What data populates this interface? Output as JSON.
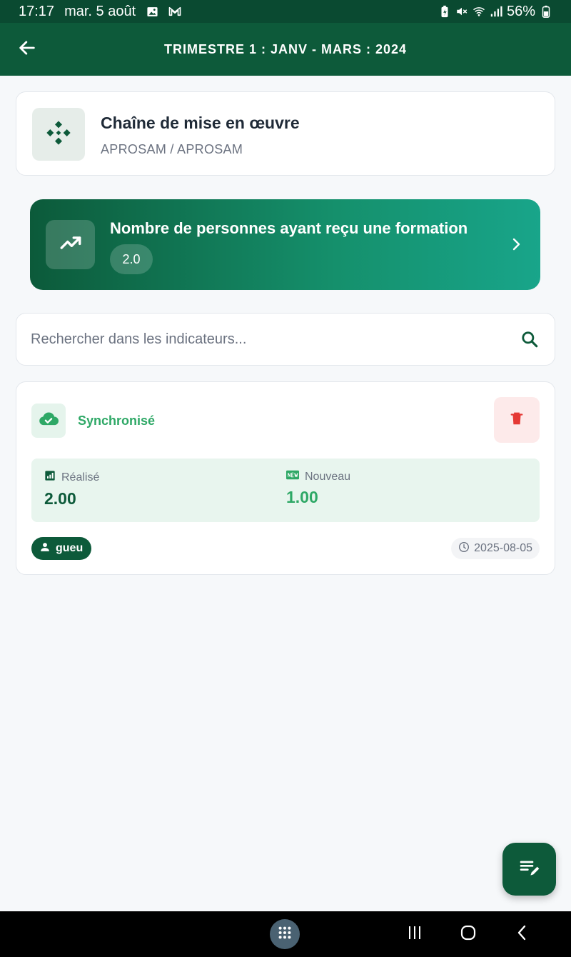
{
  "status_bar": {
    "time": "17:17",
    "date": "mar. 5 août",
    "battery": "56%",
    "icons_left": [
      "image-icon",
      "gmail-icon"
    ],
    "icons_right": [
      "battery-saver-icon",
      "mute-icon",
      "wifi-icon",
      "signal-icon",
      "battery-icon"
    ]
  },
  "app_bar": {
    "title": "TRIMESTRE 1 : JANV - MARS : 2024",
    "back_icon": "arrow-left-icon"
  },
  "chain": {
    "title": "Chaîne de mise en œuvre",
    "subtitle": "APROSAM / APROSAM",
    "icon": "diamond-arrows-icon"
  },
  "indicator": {
    "title": "Nombre de personnes ayant reçu une formation",
    "value": "2.0",
    "icon": "trending-up-icon",
    "chevron": "chevron-right-icon"
  },
  "search": {
    "placeholder": "Rechercher dans les indicateurs...",
    "value": ""
  },
  "entry": {
    "status": "Synchronisé",
    "status_icon": "cloud-check-icon",
    "delete_icon": "trash-icon",
    "realise_label": "Réalisé",
    "realise_value": "2.00",
    "nouveau_label": "Nouveau",
    "nouveau_value": "1.00",
    "user": "gueu",
    "date": "2025-08-05"
  },
  "colors": {
    "primary": "#0d5a3a",
    "status_bar": "#0a4a31",
    "success": "#2ea866",
    "danger": "#e53935",
    "background": "#f6f8fa"
  },
  "fab": {
    "icon": "edit-list-icon"
  },
  "nav": {
    "apps_icon": "apps-grid-icon",
    "recents_icon": "recents-icon",
    "home_icon": "home-icon",
    "back_icon": "nav-back-icon"
  }
}
